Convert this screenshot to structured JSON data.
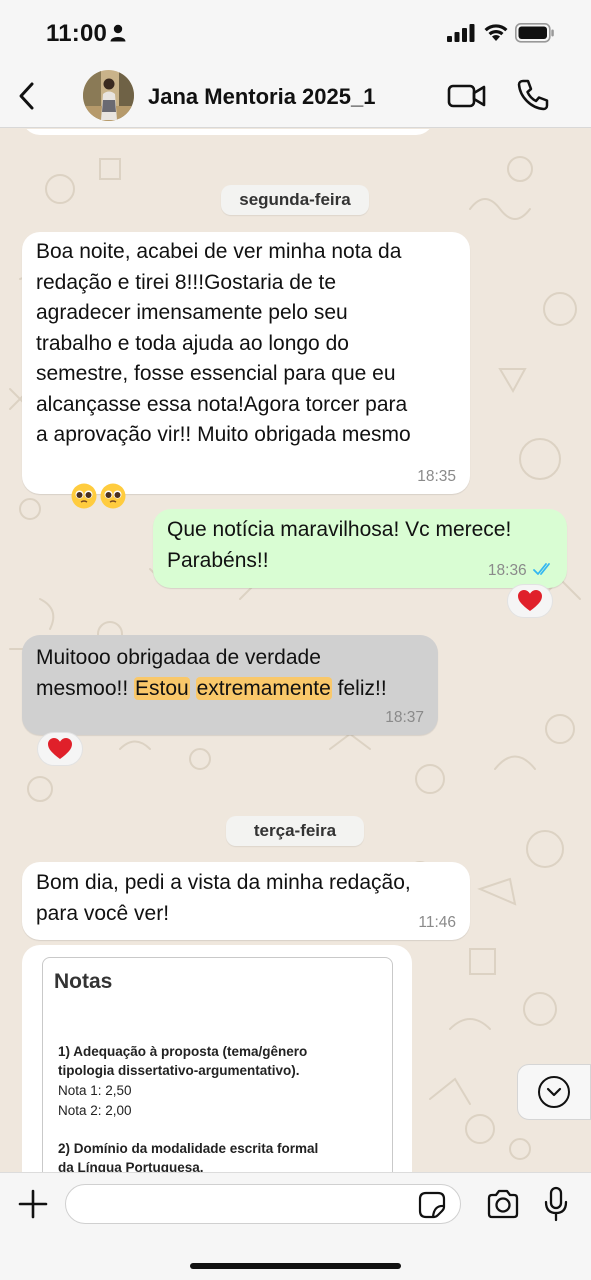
{
  "status_bar": {
    "time": "11:00"
  },
  "header": {
    "title": "Jana Mentoria 2025_1"
  },
  "dates": {
    "monday": "segunda-feira",
    "tuesday": "terça-feira"
  },
  "messages": [
    {
      "direction": "incoming",
      "text": "Boa noite, acabei de ver minha nota da\nredação e tirei 8!!!Gostaria de te\nagradecer imensamente pelo seu\ntrabalho e toda ajuda ao longo do\nsemestre, fosse essencial para que eu\nalcançasse essa nota!Agora torcer para\na aprovação vir!! Muito obrigada mesmo",
      "emojis": "🥹🥹",
      "time": "18:35"
    },
    {
      "direction": "outgoing",
      "text": "Que notícia maravilhosa! Vc merece!\nParabéns!!",
      "time": "18:36",
      "status": "read",
      "reaction": "❤️"
    },
    {
      "direction": "incoming",
      "text_parts": [
        "Muitooo obrigadaa de verdade\nmesmoo!! ",
        "Estou",
        " ",
        "extremamente",
        " feliz!!"
      ],
      "highlighted_words": [
        "Estou",
        "extremamente"
      ],
      "time": "18:37",
      "reaction": "❤️"
    },
    {
      "direction": "incoming",
      "text": "Bom dia, pedi a vista da minha redação,\npara você ver!",
      "time": "11:46"
    }
  ],
  "document_preview": {
    "title": "Notas",
    "lines": [
      "1) Adequação à proposta (tema/gênero",
      "tipologia dissertativo-argumentativo).",
      "Nota 1: 2,50",
      "Nota 2: 2,00",
      "2) Domínio da modalidade escrita formal",
      "da Língua Portuguesa."
    ]
  },
  "input": {
    "placeholder": "",
    "value": ""
  },
  "colors": {
    "outgoing_bubble": "#d9fdd3",
    "incoming_bubble": "#ffffff",
    "selected_bubble": "#d0d0d0",
    "highlight": "#f9c86a",
    "read_ticks": "#34b7f1",
    "wallpaper": "#efe7dd"
  },
  "icons": [
    "person-icon",
    "signal-icon",
    "wifi-icon",
    "battery-icon",
    "back-arrow-icon",
    "video-camera-icon",
    "phone-icon",
    "chevron-down-icon",
    "plus-icon",
    "sticker-icon",
    "camera-icon",
    "microphone-icon",
    "double-check-icon",
    "heart-icon"
  ]
}
